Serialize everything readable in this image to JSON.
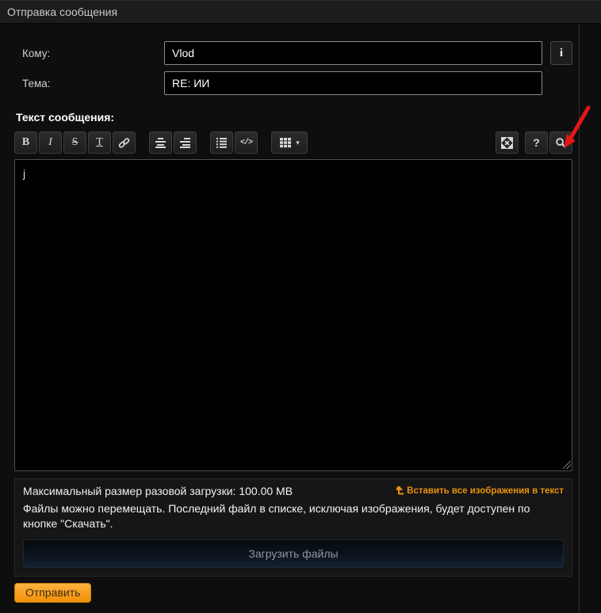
{
  "header": {
    "title": "Отправка сообщения"
  },
  "form": {
    "to_label": "Кому:",
    "to_value": "Vlod",
    "info_glyph": "i",
    "subject_label": "Тема:",
    "subject_value": "RE: ИИ",
    "message_label": "Текст сообщения:",
    "message_value": "j"
  },
  "toolbar": {
    "bold": "B",
    "italic": "I",
    "strike": "S",
    "underline": "T",
    "code": "</>",
    "table_caret": "▾",
    "help": "?"
  },
  "upload_panel": {
    "max_size_label": "Максимальный размер разовой загрузки:",
    "max_size_value": "100.00 MB",
    "insert_images_link": "Вставить все изображения в текст",
    "files_note": "Файлы можно перемещать. Последний файл в списке, исключая изображения, будет доступен по кнопке \"Скачать\".",
    "upload_button": "Загрузить файлы"
  },
  "actions": {
    "send_button": "Отправить"
  },
  "colors": {
    "accent_orange": "#f29007",
    "link_orange": "#e8920c",
    "arrow_red": "#e21717"
  }
}
